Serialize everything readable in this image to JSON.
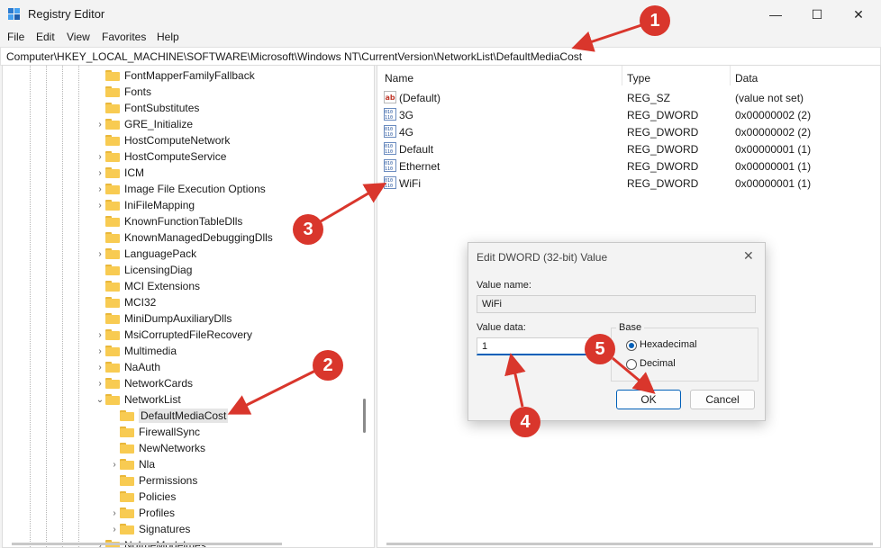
{
  "window": {
    "title": "Registry Editor",
    "controls": {
      "minimize": "—",
      "maximize": "☐",
      "close": "✕"
    }
  },
  "menu": [
    "File",
    "Edit",
    "View",
    "Favorites",
    "Help"
  ],
  "address": "Computer\\HKEY_LOCAL_MACHINE\\SOFTWARE\\Microsoft\\Windows NT\\CurrentVersion\\NetworkList\\DefaultMediaCost",
  "tree": [
    {
      "label": "FontMapperFamilyFallback",
      "expander": ""
    },
    {
      "label": "Fonts",
      "expander": ""
    },
    {
      "label": "FontSubstitutes",
      "expander": ""
    },
    {
      "label": "GRE_Initialize",
      "expander": "›"
    },
    {
      "label": "HostComputeNetwork",
      "expander": ""
    },
    {
      "label": "HostComputeService",
      "expander": "›"
    },
    {
      "label": "ICM",
      "expander": "›"
    },
    {
      "label": "Image File Execution Options",
      "expander": "›"
    },
    {
      "label": "IniFileMapping",
      "expander": "›"
    },
    {
      "label": "KnownFunctionTableDlls",
      "expander": ""
    },
    {
      "label": "KnownManagedDebuggingDlls",
      "expander": ""
    },
    {
      "label": "LanguagePack",
      "expander": "›"
    },
    {
      "label": "LicensingDiag",
      "expander": ""
    },
    {
      "label": "MCI Extensions",
      "expander": ""
    },
    {
      "label": "MCI32",
      "expander": ""
    },
    {
      "label": "MiniDumpAuxiliaryDlls",
      "expander": ""
    },
    {
      "label": "MsiCorruptedFileRecovery",
      "expander": "›"
    },
    {
      "label": "Multimedia",
      "expander": "›"
    },
    {
      "label": "NaAuth",
      "expander": "›"
    },
    {
      "label": "NetworkCards",
      "expander": "›"
    },
    {
      "label": "NetworkList",
      "expander": "⌄"
    },
    {
      "label": "DefaultMediaCost",
      "expander": "",
      "child": true,
      "selected": true
    },
    {
      "label": "FirewallSync",
      "expander": "",
      "child": true
    },
    {
      "label": "NewNetworks",
      "expander": "",
      "child": true
    },
    {
      "label": "Nla",
      "expander": "›",
      "child": true
    },
    {
      "label": "Permissions",
      "expander": "",
      "child": true
    },
    {
      "label": "Policies",
      "expander": "",
      "child": true
    },
    {
      "label": "Profiles",
      "expander": "›",
      "child": true
    },
    {
      "label": "Signatures",
      "expander": "›",
      "child": true
    },
    {
      "label": "NoImeModelmes",
      "expander": "›"
    }
  ],
  "columns": {
    "name": "Name",
    "type": "Type",
    "data": "Data"
  },
  "values": [
    {
      "name": "(Default)",
      "type": "REG_SZ",
      "data": "(value not set)",
      "icon": "string-value-icon"
    },
    {
      "name": "3G",
      "type": "REG_DWORD",
      "data": "0x00000002 (2)",
      "icon": "dword-value-icon"
    },
    {
      "name": "4G",
      "type": "REG_DWORD",
      "data": "0x00000002 (2)",
      "icon": "dword-value-icon"
    },
    {
      "name": "Default",
      "type": "REG_DWORD",
      "data": "0x00000001 (1)",
      "icon": "dword-value-icon"
    },
    {
      "name": "Ethernet",
      "type": "REG_DWORD",
      "data": "0x00000001 (1)",
      "icon": "dword-value-icon"
    },
    {
      "name": "WiFi",
      "type": "REG_DWORD",
      "data": "0x00000001 (1)",
      "icon": "dword-value-icon"
    }
  ],
  "dialog": {
    "title": "Edit DWORD (32-bit) Value",
    "close": "✕",
    "value_name_label": "Value name:",
    "value_name": "WiFi",
    "value_data_label": "Value data:",
    "value_data": "1",
    "base_label": "Base",
    "hex_label": "Hexadecimal",
    "dec_label": "Decimal",
    "ok": "OK",
    "cancel": "Cancel"
  },
  "annotations": [
    "1",
    "2",
    "3",
    "4",
    "5"
  ],
  "colors": {
    "annotation": "#d9362c",
    "accent": "#005fb8",
    "folder": "#f8cb52"
  }
}
